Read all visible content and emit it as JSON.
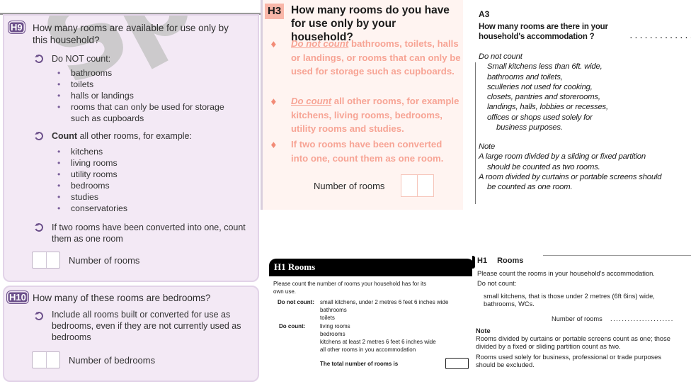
{
  "panel_h9_h10": {
    "watermark": "Spec",
    "h9": {
      "badge": "H9",
      "question": "How many rooms are available for use only by this household?",
      "do_not_count_heading": "Do NOT count:",
      "do_not_count_items": [
        "bathrooms",
        "toilets",
        "halls or landings",
        "rooms that can only be used for storage such as cupboards"
      ],
      "count_heading_bold": "Count",
      "count_heading_rest": " all other rooms, for example:",
      "count_items": [
        "kitchens",
        "living rooms",
        "utility rooms",
        "bedrooms",
        "studies",
        "conservatories"
      ],
      "converted_note": "If two rooms have been converted into one, count them as one room",
      "answer_label": "Number of rooms"
    },
    "h10": {
      "badge": "H10",
      "question": "How many of these rooms are bedrooms?",
      "instruction": "Include all rooms built or converted for use as bedrooms, even if they are not currently used as bedrooms",
      "answer_label": "Number of bedrooms"
    },
    "colors": {
      "badge": "#6b4f8a",
      "background": "#f3e9f5"
    }
  },
  "panel_h3": {
    "badge": "H3",
    "question": "How many rooms do you have for use only by your household?",
    "bullets": [
      {
        "emphasis": "Do not count",
        "text": " bathrooms, toilets, halls or landings, or rooms that can only be used for storage such as cupboards."
      },
      {
        "emphasis": "Do count",
        "text": " all other rooms, for example kitchens, living rooms, bedrooms, utility rooms and studies."
      },
      {
        "emphasis": "",
        "text": "If two rooms have been converted into one, count them as one room."
      }
    ],
    "answer_label": "Number of rooms",
    "colors": {
      "badge": "#f9b6a8",
      "text": "#f7a495",
      "background": "#fff4f1"
    }
  },
  "panel_a3": {
    "label": "A3",
    "question_line1": "How many rooms are there in your",
    "question_line2": "household's accommodation ?",
    "answer_dots": "..................",
    "do_not_count_heading": "Do not count",
    "do_not_count_items": [
      "Small kitchens less than 6ft. wide,",
      "bathrooms and toilets,",
      "sculleries not used for cooking,",
      "closets, pantries and storerooms,",
      "landings, halls, lobbies or recesses,",
      "offices or shops used solely for",
      "business purposes."
    ],
    "note_heading": "Note",
    "notes": [
      {
        "line1": "A large room divided by a sliding or fixed partition",
        "line2": "should be counted as two rooms."
      },
      {
        "line1": "A room divided by curtains or portable screens should",
        "line2": "be counted as one room."
      }
    ]
  },
  "panel_h1_black": {
    "header": "H1 Rooms",
    "intro_line1": "Please count the number of rooms your household has for its",
    "intro_line2": "own use.",
    "do_not_count_label": "Do not count:",
    "do_not_count_items": [
      "small kitchens, under 2 metres 6 feet 6 inches  wide",
      "bathrooms",
      "toilets"
    ],
    "do_count_label": "Do count:",
    "do_count_items": [
      "living  rooms",
      "bedrooms",
      "kitchens at least 2 metres 6 feet 6 inches wide",
      "all other rooms in you accommodation"
    ],
    "total_label": "The total number of rooms is"
  },
  "panel_h1_plain": {
    "code": "H1",
    "title": "Rooms",
    "intro": "Please count the rooms in your household's accommodation.",
    "do_not_count_label": "Do not count:",
    "do_not_count_line1": "small kitchens, that is those under 2 metres (6ft 6ins) wide,",
    "do_not_count_line2": "bathrooms, WCs.",
    "answer_label": "Number of rooms",
    "answer_dots": "......................",
    "note_heading": "Note",
    "note1_line1": "Rooms divided by curtains or portable screens count as one; those",
    "note1_line2": "divided by a fixed or sliding partition count as two.",
    "note2_line1": "Rooms used solely for business, professional or trade purposes",
    "note2_line2": "should be excluded."
  }
}
